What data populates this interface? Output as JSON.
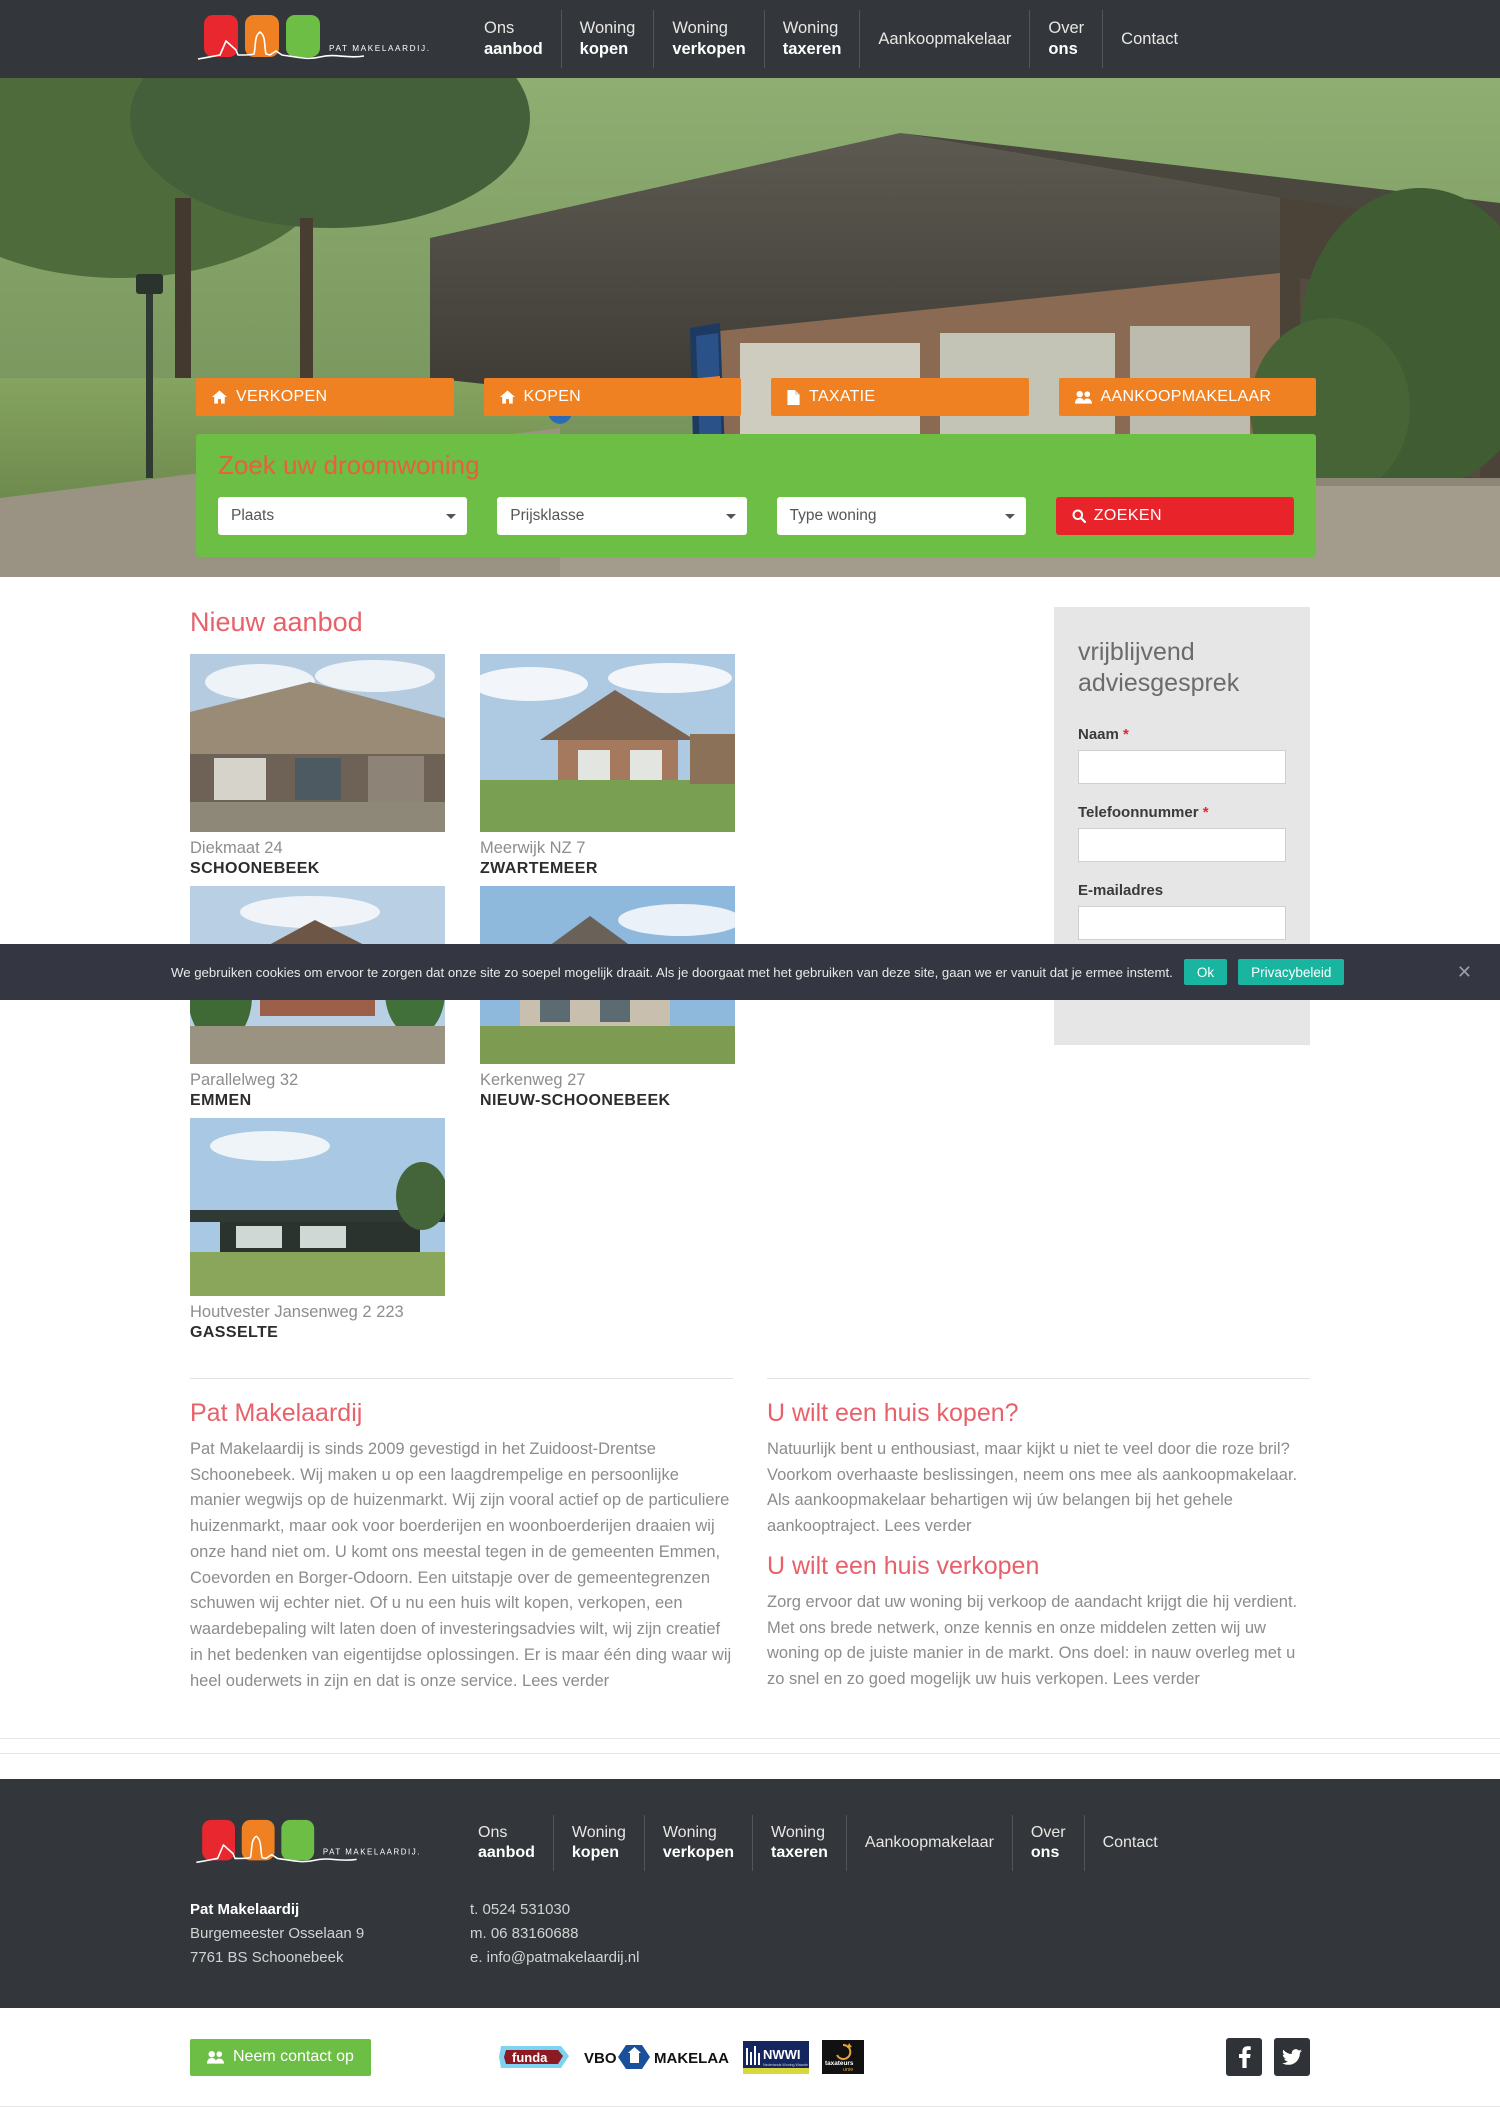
{
  "brand": {
    "name": "PAT MAKELAARDIJ.",
    "logo_colors": [
      "#e8282e",
      "#ef8122",
      "#6cbe45"
    ]
  },
  "nav": {
    "items": [
      {
        "line1": "Ons",
        "line2": "aanbod"
      },
      {
        "line1": "Woning",
        "line2": "kopen"
      },
      {
        "line1": "Woning",
        "line2": "verkopen"
      },
      {
        "line1": "Woning",
        "line2": "taxeren"
      },
      {
        "line1": "Aankoopmakelaar",
        "line2": ""
      },
      {
        "line1": "Over",
        "line2": "ons"
      },
      {
        "line1": "Contact",
        "line2": ""
      }
    ]
  },
  "hero": {
    "quick_buttons": [
      {
        "label": "VERKOPEN",
        "icon": "home-icon"
      },
      {
        "label": "KOPEN",
        "icon": "home-icon"
      },
      {
        "label": "TAXATIE",
        "icon": "document-icon"
      },
      {
        "label": "AANKOOPMAKELAAR",
        "icon": "users-icon"
      }
    ],
    "search": {
      "title": "Zoek uw droomwoning",
      "accent_color": "#6cbe45",
      "title_color": "#e8603c",
      "fields": [
        {
          "name": "plaats",
          "selected": "Plaats"
        },
        {
          "name": "prijsklasse",
          "selected": "Prijsklasse"
        },
        {
          "name": "type-woning",
          "selected": "Type woning"
        }
      ],
      "button_label": "ZOEKEN",
      "button_color": "#e8232a"
    }
  },
  "listings": {
    "title": "Nieuw aanbod",
    "items": [
      {
        "street": "Diekmaat 24",
        "city": "SCHOONEBEEK"
      },
      {
        "street": "Meerwijk NZ 7",
        "city": "ZWARTEMEER"
      },
      {
        "street": "Parallelweg 32",
        "city": "EMMEN"
      },
      {
        "street": "Kerkenweg 27",
        "city": "NIEUW-SCHOONEBEEK"
      },
      {
        "street": "Houtvester Jansenweg 2 223",
        "city": "GASSELTE"
      }
    ]
  },
  "sideform": {
    "title": "vrijblijvend adviesgesprek",
    "fields": [
      {
        "label": "Naam",
        "required": true,
        "value": ""
      },
      {
        "label": "Telefoonnummer",
        "required": true,
        "value": ""
      },
      {
        "label": "E-mailadres",
        "required": false,
        "value": ""
      }
    ],
    "submit_label": "",
    "submit_color": "#e8565e"
  },
  "text_blocks": {
    "left": {
      "title": "Pat Makelaardij",
      "body": "Pat Makelaardij is sinds 2009 gevestigd in het Zuidoost-Drentse Schoonebeek. Wij maken u op een laagdrempelige en persoonlijke manier wegwijs op de huizenmarkt. Wij zijn vooral actief op de particuliere huizenmarkt, maar ook voor boerderijen en woonboerderijen draaien wij onze hand niet om. U komt ons meestal tegen in de gemeenten Emmen, Coevorden en Borger-Odoorn. Een uitstapje over de gemeentegrenzen schuwen wij echter niet. Of u nu een huis wilt kopen, verkopen, een waardebepaling wilt laten doen of investeringsadvies wilt, wij zijn creatief in het bedenken van eigentijdse oplossingen. Er is maar één ding waar wij heel ouderwets in zijn en dat is onze service. Lees verder"
    },
    "right_top": {
      "title": "U wilt een huis kopen?",
      "body": "Natuurlijk bent u enthousiast, maar kijkt u niet te veel door die roze bril? Voorkom overhaaste beslissingen, neem ons mee als aankoopmakelaar. Als aankoopmakelaar behartigen wij úw belangen bij het gehele aankooptraject. Lees verder"
    },
    "right_bottom": {
      "title": "U wilt een huis verkopen",
      "body": "Zorg ervoor dat uw woning bij verkoop de aandacht krijgt die hij verdient. Met ons brede netwerk, onze kennis en onze middelen zetten wij uw woning op de juiste manier in de markt. Ons doel: in nauw overleg met u zo snel en zo goed mogelijk uw huis verkopen. Lees verder"
    }
  },
  "footer": {
    "company": "Pat Makelaardij",
    "address_line1": "Burgemeester Osselaan 9",
    "address_line2": "7761 BS Schoonebeek",
    "phone": "t. 0524 531030",
    "mobile": "m. 06 83160688",
    "email": "e. info@patmakelaardij.nl"
  },
  "bottombar": {
    "contact_label": "Neem contact op",
    "contact_color": "#6cbe45",
    "partners": [
      "funda",
      "VBO MAKELAAR",
      "NWWI",
      "taxateurs unie"
    ],
    "socials": [
      "facebook-icon",
      "twitter-icon"
    ]
  },
  "cookie": {
    "text": "We gebruiken cookies om ervoor te zorgen dat onze site zo soepel mogelijk draait. Als je doorgaat met het gebruiken van deze site, gaan we er vanuit dat je ermee instemt.",
    "ok_label": "Ok",
    "policy_label": "Privacybeleid",
    "close_icon": "close-icon",
    "accent_color": "#19b5a0"
  }
}
